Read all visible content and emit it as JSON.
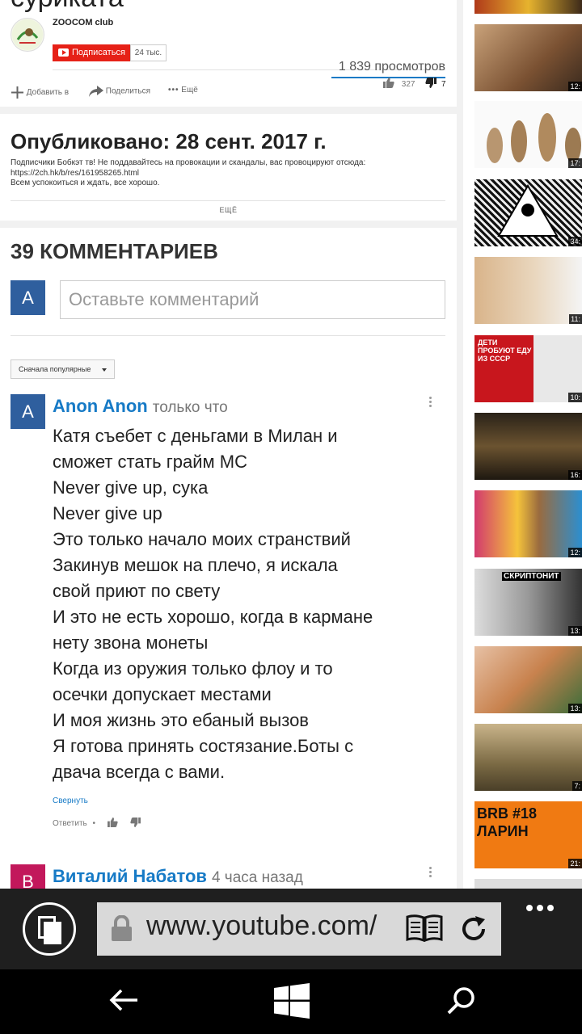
{
  "video": {
    "title_fragment": "сурикатa",
    "channel_name": "ZOOCOM club",
    "subscribe_label": "Подписаться",
    "subscriber_count": "24 тыс.",
    "views": "1 839 просмотров",
    "likes": "327",
    "dislikes": "7",
    "actions": {
      "add": "Добавить в",
      "share": "Поделиться",
      "more": "Ещё"
    }
  },
  "description": {
    "published": "Опубликовано: 28 сент. 2017 г.",
    "lines": [
      "Подписчики Бобкэт тв! Не поддавайтесь на провокации и скандалы, вас провоцируют отсюда:",
      "https://2ch.hk/b/res/161958265.html",
      "Всем успокоиться и ждать, все хорошо."
    ],
    "more_label": "ЕЩЁ"
  },
  "comments": {
    "title": "39 КОММЕНТАРИЕВ",
    "user_initial": "A",
    "input_placeholder": "Оставьте комментарий",
    "sort_label": "Сначала популярные",
    "items": [
      {
        "initial": "A",
        "author": "Anon Anon",
        "time": "только что",
        "lines": [
          "Катя съебет с деньгами в Милан и",
          "сможет стать грайм МС",
          "Never give up, сука",
          "Never give up",
          "Это только начало моих странствий",
          "Закинув мешок на плечо, я искала",
          "свой приют по свету",
          "И это не есть хорошо, когда в кармане",
          "нету звона монеты",
          "Когда из оружия только флоу и то",
          "осечки допускает местами",
          "И моя жизнь это ебаный вызов",
          "Я готова принять состязание.Боты с",
          "двача всегда с вами."
        ],
        "collapse_label": "Свернуть",
        "reply_label": "Ответить"
      },
      {
        "initial": "В",
        "author": "Виталий Набатов",
        "time": "4 часа назад"
      }
    ]
  },
  "sidebar": {
    "thumbs": [
      {
        "duration": "12:"
      },
      {
        "duration": "17:"
      },
      {
        "duration": "34:"
      },
      {
        "duration": "11:"
      },
      {
        "duration": "10:",
        "caption": "ДЕТИ ПРОБУЮТ ЕДУ ИЗ СССР"
      },
      {
        "duration": "16:"
      },
      {
        "duration": "12:"
      },
      {
        "duration": "13:",
        "caption": "СКРИПТОНИТ"
      },
      {
        "duration": "13:"
      },
      {
        "duration": "7:"
      },
      {
        "duration": "21:",
        "caption": "BRB #18 ЛАРИН"
      }
    ]
  },
  "browser": {
    "url": "www.youtube.com/"
  },
  "colors": {
    "accent": "#167ac6",
    "subscribe": "#e62117",
    "avatar_a": "#2f5f9e",
    "avatar_v": "#c2185b"
  }
}
